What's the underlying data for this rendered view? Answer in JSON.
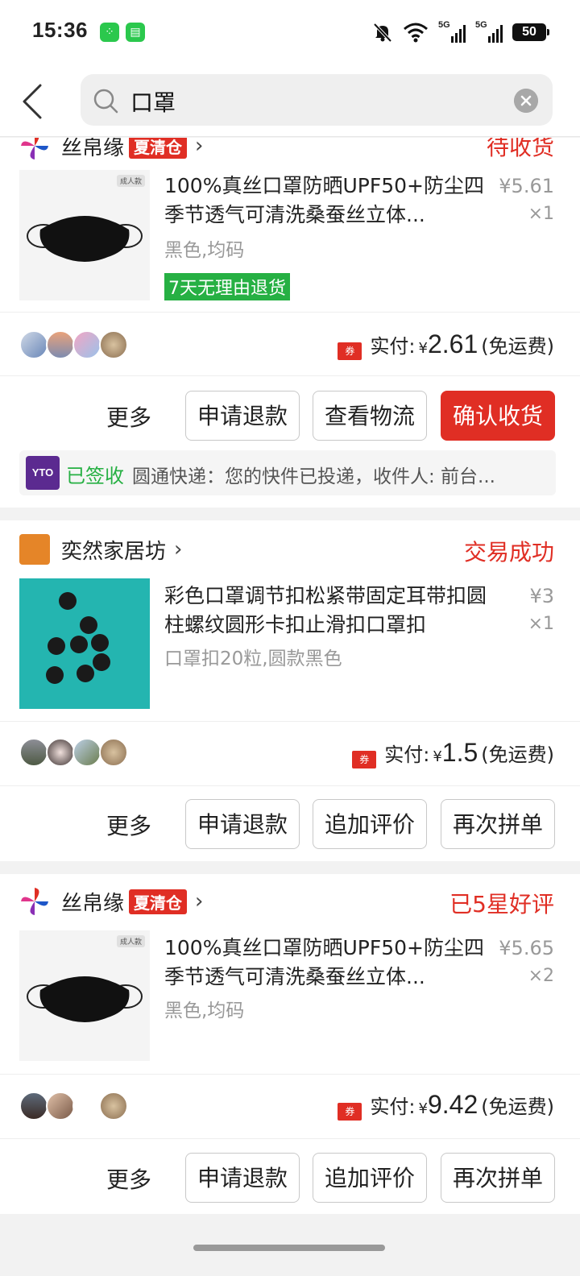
{
  "status_bar": {
    "time": "15:36",
    "signal1": "5G",
    "signal2": "5G",
    "battery": "50"
  },
  "search": {
    "query": "口罩"
  },
  "orders": [
    {
      "shop_name": "丝帛缘",
      "shop_tag": "夏清仓",
      "status": "待收货",
      "status_color": "#e02e24",
      "product_title": "100%真丝口罩防晒UPF50+防尘四季节透气可清洗桑蚕丝立体...",
      "product_spec": "黑色,均码",
      "product_price": "¥5.61",
      "product_qty": "×1",
      "return_badge": "7天无理由退货",
      "paid_label": "实付:",
      "paid_yen": "¥",
      "paid_amount": "2.61",
      "paid_note": "(免运费)",
      "more_label": "更多",
      "buttons": [
        "申请退款",
        "查看物流",
        "确认收货"
      ],
      "logistics_status": "已签收",
      "logistics_text": "圆通快递：您的快件已投递，收件人: 前台..."
    },
    {
      "shop_name": "奕然家居坊",
      "shop_logo_text": "奕然家居坊",
      "status": "交易成功",
      "product_title": "彩色口罩调节扣松紧带固定耳带扣圆柱螺纹圆形卡扣止滑扣口罩扣",
      "product_spec": "口罩扣20粒,圆款黑色",
      "product_price": "¥3",
      "product_qty": "×1",
      "paid_label": "实付:",
      "paid_yen": "¥",
      "paid_amount": "1.5",
      "paid_note": "(免运费)",
      "more_label": "更多",
      "buttons": [
        "申请退款",
        "追加评价",
        "再次拼单"
      ]
    },
    {
      "shop_name": "丝帛缘",
      "shop_tag": "夏清仓",
      "status": "已5星好评",
      "product_title": "100%真丝口罩防晒UPF50+防尘四季节透气可清洗桑蚕丝立体...",
      "product_spec": "黑色,均码",
      "product_price": "¥5.65",
      "product_qty": "×2",
      "paid_label": "实付:",
      "paid_yen": "¥",
      "paid_amount": "9.42",
      "paid_note": "(免运费)",
      "more_label": "更多",
      "buttons": [
        "申请退款",
        "追加评价",
        "再次拼单"
      ]
    }
  ],
  "colors": {
    "accent": "#e02e24",
    "green": "#26b043"
  }
}
